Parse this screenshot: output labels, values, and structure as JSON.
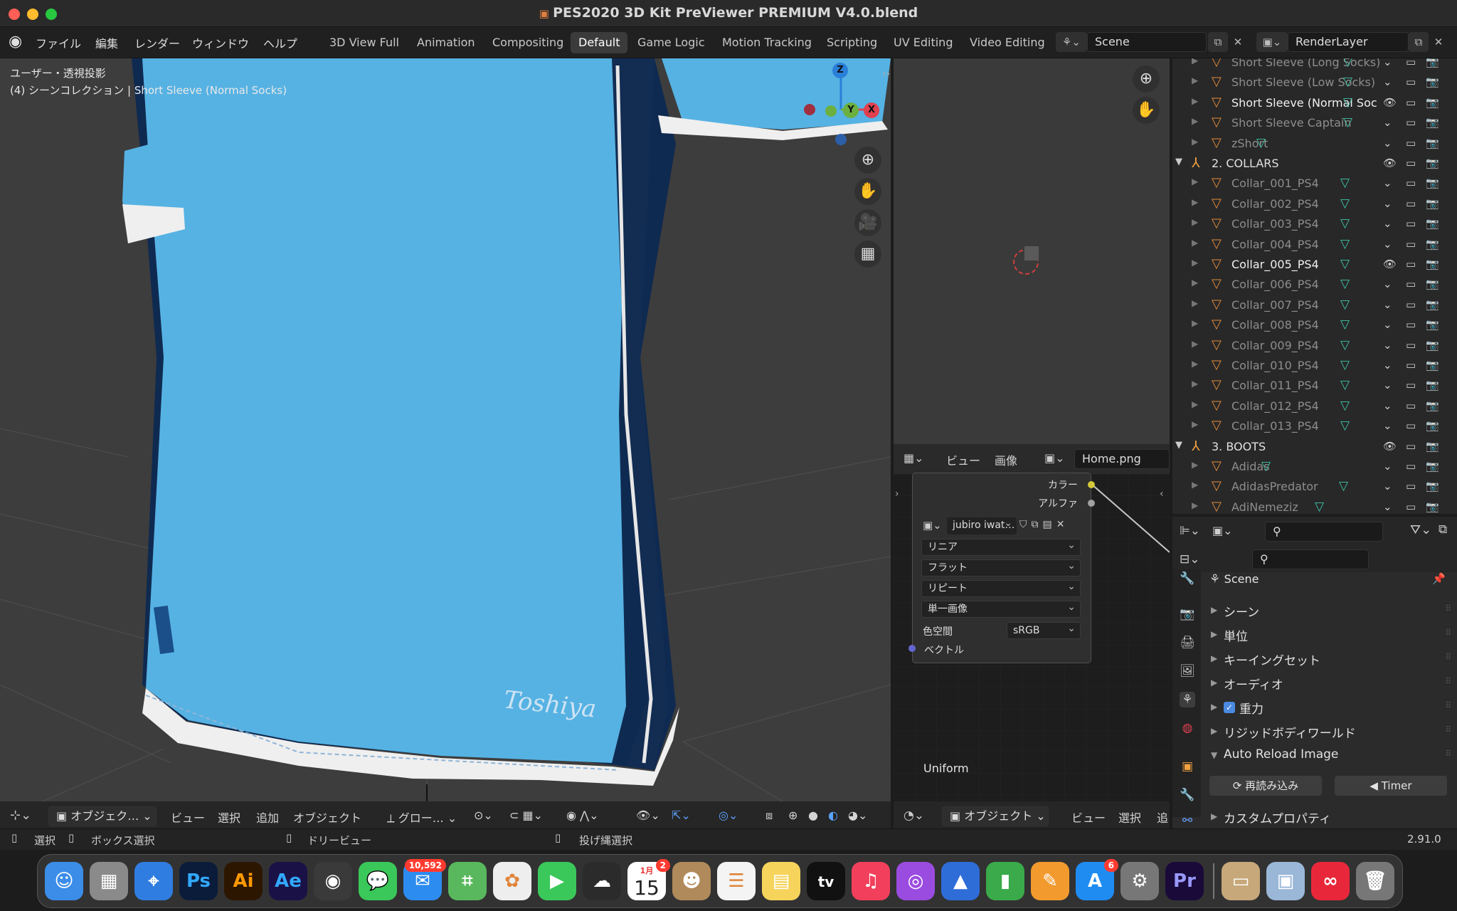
{
  "window": {
    "title": "PES2020 3D Kit PreViewer PREMIUM V4.0.blend"
  },
  "menu": [
    "ファイル",
    "編集",
    "レンダー",
    "ウィンドウ",
    "ヘルプ"
  ],
  "workspaces": [
    "3D View Full",
    "Animation",
    "Compositing",
    "Default",
    "Game Logic",
    "Motion Tracking",
    "Scripting",
    "UV Editing",
    "Video Editing"
  ],
  "active_workspace": "Default",
  "scene_field": "Scene",
  "renderlayer_field": "RenderLayer",
  "viewport": {
    "line1": "ユーザー・透視投影",
    "line2": "(4) シーンコレクション | Short Sleeve (Normal Socks)",
    "shirt_signature": "Toshiya",
    "gizmo": {
      "z": "Z",
      "y": "Y",
      "x": "X"
    },
    "header": {
      "mode": "オブジェク…",
      "menus": [
        "ビュー",
        "選択",
        "追加",
        "オブジェクト"
      ],
      "orientation": "グロー…"
    }
  },
  "image_editor": {
    "menus": [
      "ビュー",
      "画像"
    ],
    "image": "Home.png"
  },
  "node": {
    "out_color": "カラー",
    "out_alpha": "アルファ",
    "image_name": "jubiro iwat…",
    "interp": "リニア",
    "proj": "フラット",
    "ext": "リピート",
    "source": "単一画像",
    "colorspace_label": "色空間",
    "colorspace": "sRGB",
    "vector": "ベクトル",
    "uniform": "Uniform"
  },
  "node_header": {
    "mode": "オブジェクト",
    "menus": [
      "ビュー",
      "選択",
      "追"
    ]
  },
  "outliner": {
    "rows": [
      {
        "name": "Short Sleeve (Long Socks)",
        "kind": "obj"
      },
      {
        "name": "Short Sleeve (Low Socks)",
        "kind": "obj"
      },
      {
        "name": "Short Sleeve (Normal Soc",
        "kind": "obj",
        "visible": true
      },
      {
        "name": "Short Sleeve Captain",
        "kind": "obj"
      },
      {
        "name": "zShort",
        "kind": "obj"
      },
      {
        "name": "2. COLLARS",
        "kind": "coll"
      },
      {
        "name": "Collar_001_PS4",
        "kind": "obj"
      },
      {
        "name": "Collar_002_PS4",
        "kind": "obj"
      },
      {
        "name": "Collar_003_PS4",
        "kind": "obj"
      },
      {
        "name": "Collar_004_PS4",
        "kind": "obj"
      },
      {
        "name": "Collar_005_PS4",
        "kind": "obj",
        "visible": true
      },
      {
        "name": "Collar_006_PS4",
        "kind": "obj"
      },
      {
        "name": "Collar_007_PS4",
        "kind": "obj"
      },
      {
        "name": "Collar_008_PS4",
        "kind": "obj"
      },
      {
        "name": "Collar_009_PS4",
        "kind": "obj"
      },
      {
        "name": "Collar_010_PS4",
        "kind": "obj"
      },
      {
        "name": "Collar_011_PS4",
        "kind": "obj"
      },
      {
        "name": "Collar_012_PS4",
        "kind": "obj"
      },
      {
        "name": "Collar_013_PS4",
        "kind": "obj"
      },
      {
        "name": "3. BOOTS",
        "kind": "coll"
      },
      {
        "name": "Adidas",
        "kind": "obj"
      },
      {
        "name": "AdidasPredator",
        "kind": "obj"
      },
      {
        "name": "AdiNemeziz",
        "kind": "obj"
      }
    ]
  },
  "properties": {
    "title": "Scene",
    "sections": [
      "シーン",
      "単位",
      "キーイングセット",
      "オーディオ",
      "重力",
      "リジッドボディワールド",
      "Auto Reload Image"
    ],
    "reload_btn": "再読み込み",
    "timer_btn": "Timer",
    "custom": "カスタムプロパティ"
  },
  "status": {
    "select": "選択",
    "box": "ボックス選択",
    "dolly": "ドリービュー",
    "lasso": "投げ縄選択",
    "version": "2.91.0"
  },
  "dock": {
    "mail_badge": "10,592",
    "cal_month": "1月",
    "cal_day": "15",
    "cal_badge": "2",
    "appstore_badge": "6",
    "apps": [
      {
        "name": "finder",
        "label": "",
        "color": "#3b8de8"
      },
      {
        "name": "launchpad",
        "label": "",
        "color": "#8a8a8a"
      },
      {
        "name": "safari",
        "label": "",
        "color": "#2f7de0"
      },
      {
        "name": "photoshop",
        "label": "Ps",
        "color": "#0b1c3b"
      },
      {
        "name": "illustrator",
        "label": "Ai",
        "color": "#2d1600"
      },
      {
        "name": "aftereffects",
        "label": "Ae",
        "color": "#1a1147"
      },
      {
        "name": "blender",
        "label": "",
        "color": "#3a3a3a"
      },
      {
        "name": "messages",
        "label": "",
        "color": "#3bc85a"
      },
      {
        "name": "mail",
        "label": "",
        "color": "#2d8cf0"
      },
      {
        "name": "maps",
        "label": "",
        "color": "#59b85d"
      },
      {
        "name": "photos",
        "label": "",
        "color": "#eeeeee"
      },
      {
        "name": "facetime",
        "label": "",
        "color": "#3bc85a"
      },
      {
        "name": "onedrive",
        "label": "",
        "color": "#2b2b2b"
      },
      {
        "name": "calendar",
        "label": "",
        "color": "#ffffff"
      },
      {
        "name": "contacts",
        "label": "",
        "color": "#b08a5a"
      },
      {
        "name": "reminders",
        "label": "",
        "color": "#f4f4f4"
      },
      {
        "name": "notes",
        "label": "",
        "color": "#f6d45c"
      },
      {
        "name": "appletv",
        "label": "tv",
        "color": "#111111"
      },
      {
        "name": "music",
        "label": "",
        "color": "#f2405c"
      },
      {
        "name": "podcasts",
        "label": "",
        "color": "#9b4ce0"
      },
      {
        "name": "keynote",
        "label": "",
        "color": "#2e6cd8"
      },
      {
        "name": "numbers",
        "label": "",
        "color": "#3aaa4a"
      },
      {
        "name": "pages",
        "label": "",
        "color": "#f29a2e"
      },
      {
        "name": "appstore",
        "label": "",
        "color": "#1f8cf2"
      },
      {
        "name": "systemprefs",
        "label": "",
        "color": "#777777"
      },
      {
        "name": "premiere",
        "label": "Pr",
        "color": "#1a0a3a"
      },
      {
        "name": "files",
        "label": "",
        "color": "#c7a87a"
      },
      {
        "name": "preview",
        "label": "",
        "color": "#9ab7d8"
      },
      {
        "name": "creativecloud",
        "label": "",
        "color": "#e8283a"
      },
      {
        "name": "trash",
        "label": "",
        "color": "#777777"
      }
    ]
  }
}
